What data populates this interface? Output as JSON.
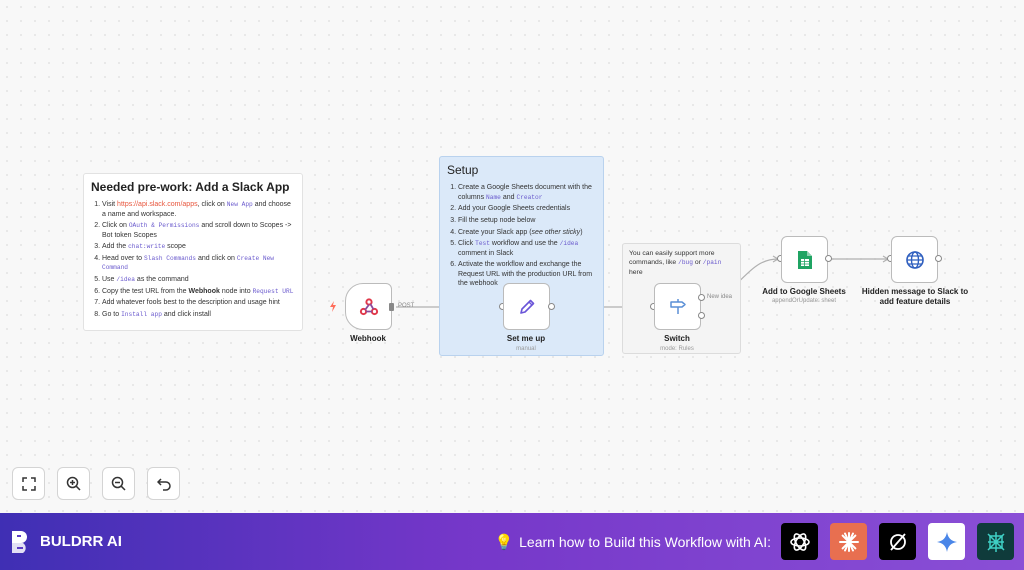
{
  "prework": {
    "title": "Needed pre-work: Add a Slack App",
    "s1_pre": "Visit ",
    "s1_link": "https://api.slack.com/apps",
    "s1_mid": ", click on ",
    "s1_code": "New App",
    "s1_post": " and choose a name and workspace.",
    "s2_pre": "Click on ",
    "s2_code": "OAuth & Permissions",
    "s2_post": " and scroll down to Scopes -> Bot token Scopes",
    "s3_pre": "Add the ",
    "s3_code": "chat:write",
    "s3_post": " scope",
    "s4_pre": "Head over to ",
    "s4_code1": "Slash Commands",
    "s4_mid": " and click on ",
    "s4_code2": "Create New Command",
    "s5_pre": "Use ",
    "s5_code": "/idea",
    "s5_post": " as the command",
    "s6_pre": "Copy the test URL from the ",
    "s6_bold": "Webhook",
    "s6_mid": " node into ",
    "s6_code": "Request URL",
    "s7": "Add whatever fools best to the description and usage hint",
    "s8_pre": "Go to ",
    "s8_code": "Install app",
    "s8_post": " and click install"
  },
  "setup": {
    "title": "Setup",
    "s1_pre": "Create a Google Sheets document with the columns ",
    "s1_code1": "Name",
    "s1_mid": " and ",
    "s1_code2": "Creator",
    "s2": "Add your Google Sheets credentials",
    "s3": "Fill the setup node below",
    "s4_pre": "Create your Slack app (",
    "s4_ital": "see other sticky",
    "s4_post": ")",
    "s5_pre": "Click ",
    "s5_code1": "Test",
    "s5_mid": " workflow and use the ",
    "s5_code2": "/idea",
    "s5_post": " comment in Slack",
    "s6": "Activate the workflow and exchange the Request URL with the production URL from the webhook"
  },
  "switch_note": {
    "pre": "You can easily support more commands, like ",
    "code1": "/bug",
    "mid": " or ",
    "code2": "/pain",
    "post": " here"
  },
  "nodes": {
    "webhook": {
      "label": "Webhook",
      "edge": "POST"
    },
    "setme": {
      "label": "Set me up",
      "sub": "manual"
    },
    "switch": {
      "label": "Switch",
      "sub": "mode: Rules",
      "edge": "New idea"
    },
    "sheets": {
      "label": "Add to Google Sheets",
      "sub": "appendOrUpdate: sheet"
    },
    "http": {
      "label": "Hidden message to Slack to add feature details"
    }
  },
  "controls": [
    "fit-view",
    "zoom-in",
    "zoom-out",
    "undo"
  ],
  "footer": {
    "brand": "BULDRR AI",
    "learn": "Learn how to Build this Workflow with AI:",
    "ai_icons": [
      "chatgpt-icon",
      "claude-icon",
      "perplexity-icon",
      "gemini-icon",
      "deepseek-icon"
    ]
  },
  "colors": {
    "node_border": "#bbbbbb",
    "setup_bg": "#dbe9f9",
    "link": "#e8563d",
    "code": "#6a5acd",
    "footer_start": "#3f2fb4",
    "footer_end": "#8a4fd6"
  }
}
